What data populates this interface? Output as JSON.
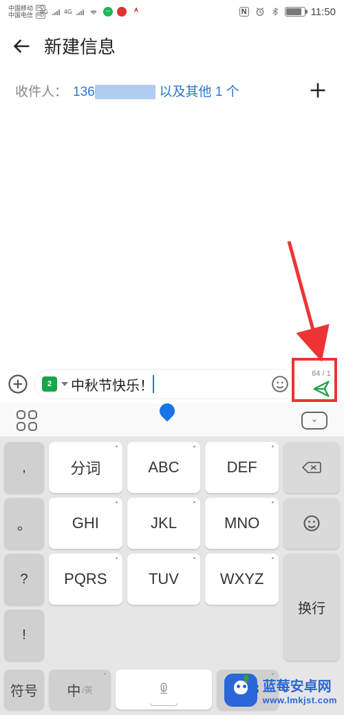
{
  "status_bar": {
    "carrier1": "中国移动",
    "carrier2": "中国电信",
    "hd": "HD",
    "net": "4G",
    "nfc": "N",
    "time": "11:50"
  },
  "header": {
    "title": "新建信息"
  },
  "recipient": {
    "label": "收件人：",
    "prefix": "136",
    "suffix": "以及其他 1 个"
  },
  "compose": {
    "sim": "2",
    "text": "中秋节快乐！",
    "char_count": "64 / 1"
  },
  "keyboard": {
    "left": [
      ",",
      "。",
      "?",
      "!"
    ],
    "main": [
      [
        "分词",
        "ABC",
        "DEF"
      ],
      [
        "GHI",
        "JKL",
        "MNO"
      ],
      [
        "PQRS",
        "TUV",
        "WXYZ"
      ]
    ],
    "right_backspace": "⌫",
    "right_enter": "换行",
    "bottom": {
      "symbols": "符号",
      "lang_main": "中",
      "lang_sub": "/英",
      "numbers": "123"
    }
  },
  "watermark": {
    "line1": "蓝莓安卓网",
    "line2": "www.lmkjst.com"
  }
}
